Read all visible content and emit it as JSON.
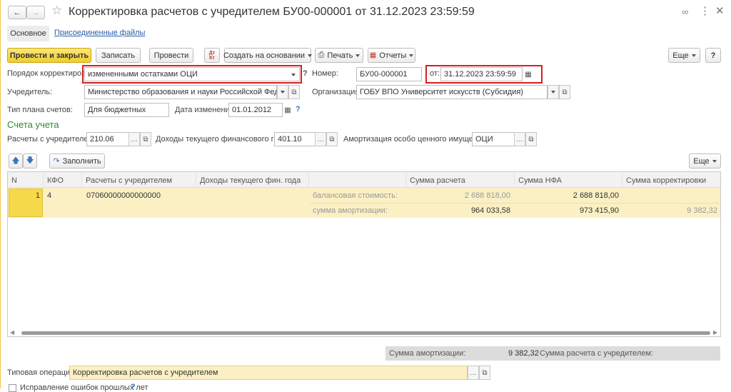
{
  "window": {
    "title": "Корректировка расчетов с учредителем БУ00-000001 от 31.12.2023 23:59:59"
  },
  "tabs": [
    {
      "label": "Основное"
    },
    {
      "label": "Присоединенные файлы"
    }
  ],
  "toolbar": {
    "post_close": "Провести и закрыть",
    "save": "Записать",
    "post": "Провести",
    "create_based": "Создать на основании",
    "print": "Печать",
    "reports": "Отчеты",
    "more": "Еще",
    "help": "?",
    "dt_kt": "Дт Кт"
  },
  "form": {
    "order_label": "Порядок корректировки:",
    "order_value": "измененными остатками ОЦИ",
    "number_label": "Номер:",
    "number_value": "БУ00-000001",
    "from_label": "от:",
    "date_value": "31.12.2023 23:59:59",
    "founder_label": "Учредитель:",
    "founder_value": "Министерство образования и науки Российской Федерации",
    "org_label": "Организация:",
    "org_value": "ГОБУ ВПО Университет искусств (Субсидия)",
    "plan_label": "Тип плана счетов:",
    "plan_value": "Для бюджетных",
    "change_label": "Дата изменения:",
    "change_value": "01.01.2012",
    "section_title": "Счета учета",
    "calc_label": "Расчеты с учредителем:",
    "calc_value": "210.06",
    "income_label": "Доходы текущего финансового года:",
    "income_value": "401.10",
    "amort_label": "Амортизация особо ценного имущества:",
    "amort_value": "ОЦИ"
  },
  "table_toolbar": {
    "fill": "Заполнить",
    "more": "Еще"
  },
  "table": {
    "headers": [
      "N",
      "КФО",
      "Расчеты с учредителем",
      "Доходы текущего фин. года",
      "",
      "Сумма расчета",
      "Сумма НФА",
      "Сумма корректировки"
    ],
    "row": {
      "n": "1",
      "kfo": "4",
      "calc": "07060000000000000",
      "line1": {
        "label": "балансовая стоимость:",
        "sum": "2 688 818,00",
        "nfa": "2 688 818,00",
        "corr": ""
      },
      "line2": {
        "label": "сумма амортизации:",
        "sum": "964 033,58",
        "nfa": "973 415,90",
        "corr": "9 382,32"
      }
    }
  },
  "footer": {
    "amort_label": "Сумма амортизации:",
    "amort_value": "9 382,32",
    "calc_label": "Сумма расчета с учредителем:",
    "calc_value": "",
    "operation_label": "Типовая операция:",
    "operation_value": "Корректировка расчетов с учредителем",
    "fix_label": "Исправление ошибок прошлых лет"
  },
  "colors": {
    "accent": "#f5d94b",
    "row_bg": "#fbf0c4",
    "highlight_border": "#d61f1f",
    "section": "#2e8b2e"
  }
}
